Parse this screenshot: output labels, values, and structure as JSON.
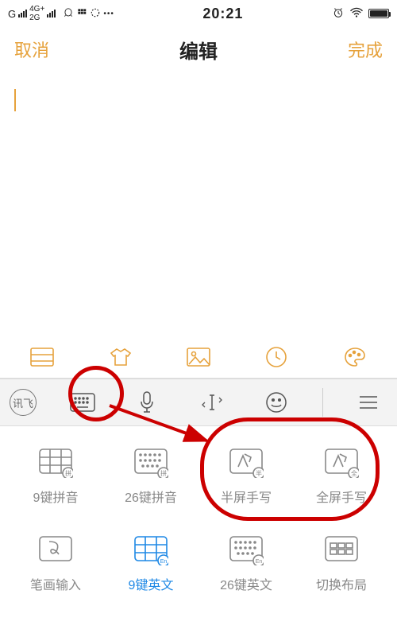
{
  "status": {
    "carrier": "G",
    "net1": "4G+",
    "net2": "2G",
    "time": "20:21"
  },
  "header": {
    "cancel": "取消",
    "title": "编辑",
    "done": "完成"
  },
  "tools": {
    "list": "list-icon",
    "shirt": "shirt-icon",
    "image": "image-icon",
    "clock": "clock-icon",
    "palette": "palette-icon"
  },
  "kbd_tabs": {
    "logo": "讯飞",
    "keyboard": "keyboard-icon",
    "mic": "mic-icon",
    "cursor": "text-cursor-icon",
    "emoji": "emoji-icon",
    "menu": "menu-icon"
  },
  "input_methods": {
    "row1": [
      {
        "label": "9键拼音",
        "name": "im-9key-pinyin",
        "active": false,
        "icon": "grid9-pin"
      },
      {
        "label": "26键拼音",
        "name": "im-26key-pinyin",
        "active": false,
        "icon": "grid26-pin"
      },
      {
        "label": "半屏手写",
        "name": "im-half-handwrite",
        "active": false,
        "icon": "hand-half"
      },
      {
        "label": "全屏手写",
        "name": "im-full-handwrite",
        "active": false,
        "icon": "hand-full"
      }
    ],
    "row2": [
      {
        "label": "笔画输入",
        "name": "im-stroke",
        "active": false,
        "icon": "stroke"
      },
      {
        "label": "9键英文",
        "name": "im-9key-en",
        "active": true,
        "icon": "grid9-en"
      },
      {
        "label": "26键英文",
        "name": "im-26key-en",
        "active": false,
        "icon": "grid26-en"
      },
      {
        "label": "切换布局",
        "name": "im-switch-layout",
        "active": false,
        "icon": "switch"
      }
    ]
  }
}
